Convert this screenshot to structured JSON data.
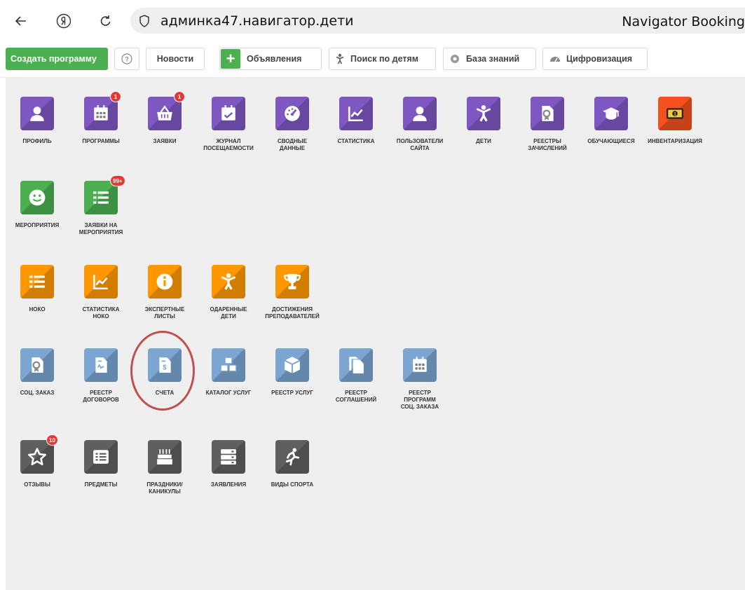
{
  "browser": {
    "url": "админка47.навигатор.дети",
    "title": "Navigator Booking"
  },
  "toolbar": {
    "create_program": "Создать программу",
    "help_icon": "help-icon",
    "news": "Новости",
    "announcements": "Объявления",
    "child_search": "Поиск по детям",
    "knowledge_base": "База знаний",
    "digitalization": "Цифровизация"
  },
  "colors": {
    "purple": "#7e57c2",
    "green": "#4caf50",
    "orange": "#ff9800",
    "blue_grey": "#7aa6d1",
    "dark_grey": "#5f5f5f",
    "red_orange": "#f4511e",
    "badge": "#e53935",
    "highlight_circle": "#c0504d"
  },
  "tiles": [
    {
      "label": "Профиль",
      "icon": "user-icon"
    },
    {
      "label": "Программы",
      "icon": "calendar-icon",
      "badge": "1"
    },
    {
      "label": "Заявки",
      "icon": "basket-icon",
      "badge": "1"
    },
    {
      "label": "Журнал\nпосещаемости",
      "icon": "calendar-check-icon"
    },
    {
      "label": "Сводные\nданные",
      "icon": "gauge-icon"
    },
    {
      "label": "Статистика",
      "icon": "chart-line-icon"
    },
    {
      "label": "Пользователи\nсайта",
      "icon": "user-icon"
    },
    {
      "label": "Дети",
      "icon": "child-icon"
    },
    {
      "label": "Реестры\nзачислений",
      "icon": "certificate-icon"
    },
    {
      "label": "Обучающиеся",
      "icon": "graduation-cap-icon"
    },
    {
      "label": "Инвентаризация",
      "icon": "money-icon"
    },
    {
      "label": "Мероприятия",
      "icon": "smile-icon"
    },
    {
      "label": "Заявки на\nмероприятия",
      "icon": "list-icon",
      "badge": "99+"
    },
    {
      "label": "НОКО",
      "icon": "list-icon"
    },
    {
      "label": "Статистика\nНОКО",
      "icon": "chart-line-icon"
    },
    {
      "label": "Экспертные\nлисты",
      "icon": "info-icon"
    },
    {
      "label": "Одаренные\nдети",
      "icon": "child-icon"
    },
    {
      "label": "Достижения\nпреподавателей",
      "icon": "trophy-icon"
    },
    {
      "label": "Соц. заказ",
      "icon": "certificate-icon"
    },
    {
      "label": "Реестр\nдоговоров",
      "icon": "contract-icon"
    },
    {
      "label": "Счета",
      "icon": "invoice-icon"
    },
    {
      "label": "Каталог услуг",
      "icon": "cubes-icon"
    },
    {
      "label": "Реестр услуг",
      "icon": "cube-icon"
    },
    {
      "label": "Реестр\nсоглашений",
      "icon": "copy-icon"
    },
    {
      "label": "Реестр\nпрограмм\nсоц. заказа",
      "icon": "calendar-icon"
    },
    {
      "label": "Отзывы",
      "icon": "star-icon",
      "badge": "10"
    },
    {
      "label": "Предметы",
      "icon": "list-alt-icon"
    },
    {
      "label": "Праздники/\nканикулы",
      "icon": "cake-icon"
    },
    {
      "label": "Заявления",
      "icon": "server-icon"
    },
    {
      "label": "Виды спорта",
      "icon": "running-icon"
    }
  ]
}
